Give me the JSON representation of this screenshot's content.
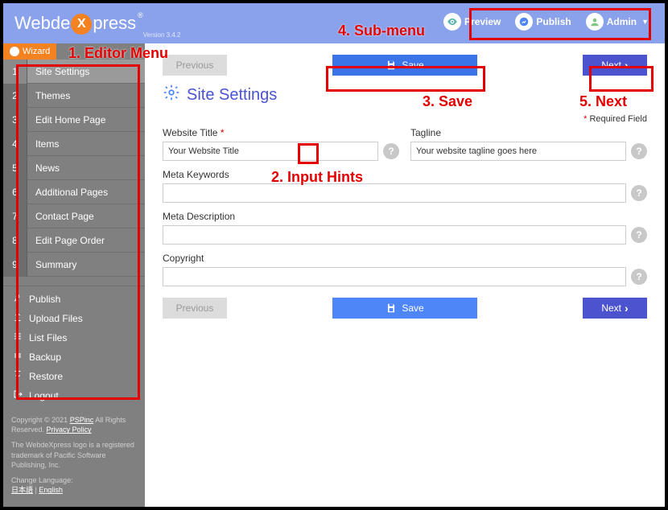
{
  "app": {
    "name_left": "Webde",
    "name_right": "press",
    "version": "Version 3.4.2"
  },
  "topmenu": {
    "preview": "Preview",
    "publish": "Publish",
    "admin": "Admin"
  },
  "sidebar": {
    "wizard": "Wizard",
    "items": [
      {
        "num": "1",
        "label": "Site Settings",
        "active": true
      },
      {
        "num": "2",
        "label": "Themes"
      },
      {
        "num": "3",
        "label": "Edit Home Page"
      },
      {
        "num": "4",
        "label": "Items"
      },
      {
        "num": "5",
        "label": "News"
      },
      {
        "num": "6",
        "label": "Additional Pages"
      },
      {
        "num": "7",
        "label": "Contact Page"
      },
      {
        "num": "8",
        "label": "Edit Page Order"
      },
      {
        "num": "9",
        "label": "Summary"
      }
    ],
    "actions": [
      {
        "icon": "rocket",
        "label": "Publish"
      },
      {
        "icon": "upload",
        "label": "Upload Files"
      },
      {
        "icon": "list",
        "label": "List Files"
      },
      {
        "icon": "backup",
        "label": "Backup"
      },
      {
        "icon": "restore",
        "label": "Restore"
      },
      {
        "icon": "logout",
        "label": "Logout"
      }
    ]
  },
  "footer": {
    "copyright_prefix": "Copyright © 2021 ",
    "pspinc": "PSPinc",
    "rights": " All Rights Reserved. ",
    "privacy": "Privacy Policy",
    "trademark": "The WebdeXpress logo is a registered trademark of Pacific Software Publishing, Inc.",
    "change_lang": "Change Language:",
    "lang_jp": "日本語",
    "lang_sep": " | ",
    "lang_en": "English"
  },
  "page": {
    "title": "Site Settings",
    "required_label": "Required Field",
    "prev": "Previous",
    "save": "Save",
    "next": "Next",
    "fields": {
      "website_title": {
        "label": "Website Title",
        "required": true,
        "value": "Your Website Title"
      },
      "tagline": {
        "label": "Tagline",
        "required": false,
        "value": "Your website tagline goes here"
      },
      "meta_keywords": {
        "label": "Meta Keywords",
        "required": false,
        "value": ""
      },
      "meta_description": {
        "label": "Meta Description",
        "required": false,
        "value": ""
      },
      "copyright": {
        "label": "Copyright",
        "required": false,
        "value": ""
      }
    }
  },
  "annotations": {
    "a1": "1. Editor Menu",
    "a2": "2. Input Hints",
    "a3": "3. Save",
    "a4": "4. Sub-menu",
    "a5": "5. Next"
  }
}
